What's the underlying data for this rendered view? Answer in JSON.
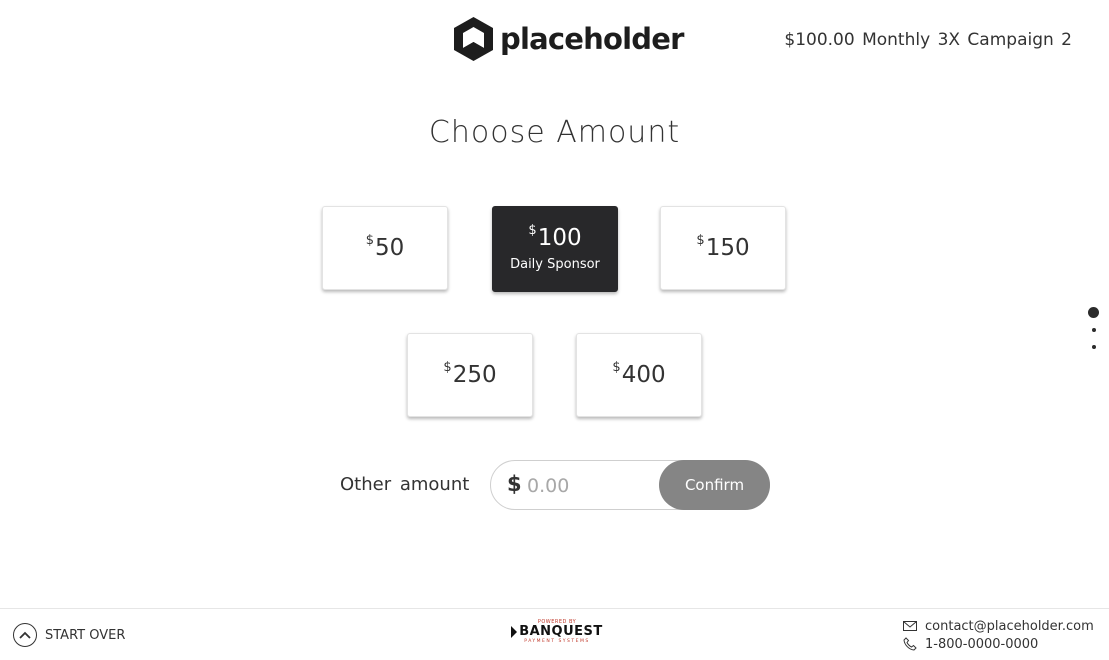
{
  "header": {
    "logo_text": "placeholder",
    "campaign": "$100.00 Monthly 3X Campaign 2"
  },
  "main": {
    "heading": "Choose Amount",
    "currency_symbol": "$",
    "amounts": [
      {
        "value": "50",
        "label": "",
        "selected": false
      },
      {
        "value": "100",
        "label": "Daily Sponsor",
        "selected": true
      },
      {
        "value": "150",
        "label": "",
        "selected": false
      },
      {
        "value": "250",
        "label": "",
        "selected": false
      },
      {
        "value": "400",
        "label": "",
        "selected": false
      }
    ],
    "other": {
      "label": "Other amount",
      "currency": "$",
      "value": "",
      "placeholder": "0.00",
      "confirm_label": "Confirm"
    }
  },
  "pagination": {
    "current": 1,
    "total": 3
  },
  "footer": {
    "start_over": "START OVER",
    "powered_by": "POWERED BY",
    "brand": "BANQUEST",
    "brand_sub": "PAYMENT SYSTEMS",
    "email": "contact@placeholder.com",
    "phone": "1-800-0000-0000"
  },
  "colors": {
    "selected_card": "#28282a",
    "confirm_button": "#858585",
    "text": "#333333",
    "brand_accent": "#c0392b"
  },
  "icons": [
    "logo-hexagon-icon",
    "chevron-up-circle-icon",
    "mail-icon",
    "phone-icon",
    "banquest-logo-icon"
  ]
}
